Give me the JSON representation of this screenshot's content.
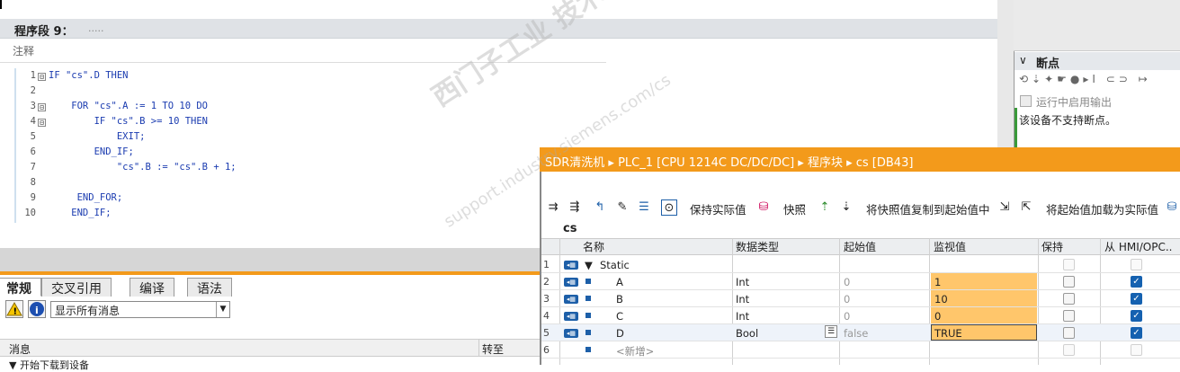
{
  "segment": {
    "title": "程序段 9：",
    "dots": ".....",
    "comment": "注释"
  },
  "code": [
    {
      "ln": "1",
      "fold": "⊟",
      "text": "IF \"cs\".D THEN"
    },
    {
      "ln": "2",
      "fold": "",
      "text": ""
    },
    {
      "ln": "3",
      "fold": "⊟",
      "text": "    FOR \"cs\".A := 1 TO 10 DO"
    },
    {
      "ln": "4",
      "fold": "⊟",
      "text": "        IF \"cs\".B >= 10 THEN"
    },
    {
      "ln": "5",
      "fold": "",
      "text": "            EXIT;"
    },
    {
      "ln": "6",
      "fold": "",
      "text": "        END_IF;"
    },
    {
      "ln": "7",
      "fold": "",
      "text": "            \"cs\".B := \"cs\".B + 1;"
    },
    {
      "ln": "8",
      "fold": "",
      "text": ""
    },
    {
      "ln": "9",
      "fold": "",
      "text": "     END_FOR;"
    },
    {
      "ln": "10",
      "fold": "",
      "text": "    END_IF;"
    }
  ],
  "breakpoints": {
    "chevron": "∨",
    "title": "断点",
    "toolbar": "⟲⇣✦☛●▸I ⊂⊃ ↦",
    "checkbox_label": "运行中启用输出",
    "message": "该设备不支持断点。"
  },
  "inspector": {
    "tabs": [
      "常规",
      "交叉引用",
      "编译",
      "语法"
    ],
    "warn_icon": "warning-icon",
    "info_icon": "info-icon",
    "filter_value": "显示所有消息",
    "col_message": "消息",
    "col_goto": "转至",
    "partial_row": "▼  开始下载到设备"
  },
  "db": {
    "breadcrumb": "SDR清洗机  ▸  PLC_1 [CPU 1214C DC/DC/DC]  ▸  程序块  ▸  cs [DB43]",
    "toolbar": {
      "keep_actual": "保持实际值",
      "snapshot": "快照",
      "copy_snapshot": "将快照值复制到起始值中",
      "load_start": "将起始值加载为实际值"
    },
    "name": "cs",
    "headers": [
      "名称",
      "数据类型",
      "起始值",
      "监视值",
      "保持",
      "从 HMI/OPC.."
    ],
    "rows": [
      {
        "n": "1",
        "name": "Static",
        "type": "",
        "start": "",
        "monitor": "",
        "retain": false,
        "hmi": false,
        "is_group": true
      },
      {
        "n": "2",
        "name": "A",
        "type": "Int",
        "start": "0",
        "monitor": "1",
        "retain": false,
        "hmi": true
      },
      {
        "n": "3",
        "name": "B",
        "type": "Int",
        "start": "0",
        "monitor": "10",
        "retain": false,
        "hmi": true
      },
      {
        "n": "4",
        "name": "C",
        "type": "Int",
        "start": "0",
        "monitor": "0",
        "retain": false,
        "hmi": true
      },
      {
        "n": "5",
        "name": "D",
        "type": "Bool",
        "start": "false",
        "monitor": "TRUE",
        "retain": false,
        "hmi": true
      },
      {
        "n": "6",
        "name": "<新增>",
        "type": "",
        "start": "",
        "monitor": "",
        "retain": false,
        "hmi": false
      }
    ]
  },
  "watermark": {
    "line1": "西门子工业 技术论坛",
    "line2": "support.industry.siemens.com/cs"
  },
  "colors": {
    "accent": "#f39a1b",
    "monitor_bg": "#ffc66b",
    "code_blue": "#1a3bb0"
  }
}
